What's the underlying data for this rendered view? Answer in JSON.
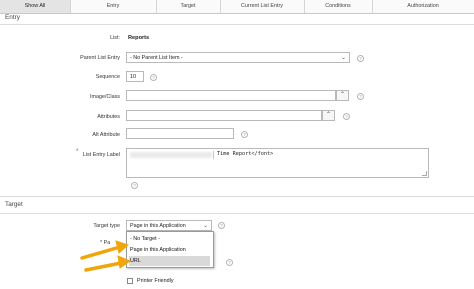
{
  "tabs": [
    "Show All",
    "Entry",
    "Target",
    "Current List Entry",
    "Conditions",
    "Authorization"
  ],
  "entry_section": {
    "title": "Entry"
  },
  "fields": {
    "list": {
      "label": "List:",
      "value": "Reports"
    },
    "parent": {
      "label": "Parent List Entry",
      "value": "- No Parent List Item -"
    },
    "sequence": {
      "label": "Sequence",
      "value": "10"
    },
    "image_class": {
      "label": "Image/Class",
      "value": ""
    },
    "attributes": {
      "label": "Attributes",
      "value": ""
    },
    "alt_attribute": {
      "label": "Alt Attribute",
      "value": ""
    },
    "list_entry_label": {
      "label": "List Entry Label",
      "required_mark": "*",
      "value": "Time Report</font>"
    }
  },
  "target_section": {
    "title": "Target",
    "target_type": {
      "label": "Target type",
      "value": "Page in this Application"
    },
    "hidden_label_fragment": "* Pa",
    "dropdown": {
      "options": [
        "- No Target -",
        "Page in this Application",
        "URL"
      ],
      "highlighted": "URL"
    },
    "printer_friendly": {
      "label": "Printer Friendly",
      "checked": false
    }
  },
  "icons": {
    "help": "?",
    "lookup": "⌃",
    "chevron": "⌄"
  },
  "colors": {
    "arrow": "#f0a60a",
    "highlight": "#d9d9d9"
  }
}
